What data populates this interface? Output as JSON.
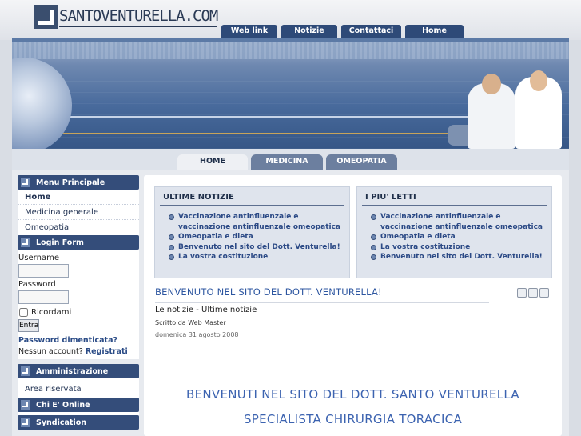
{
  "site": {
    "logo_text": "SANTOVENTURELLA.COM"
  },
  "top_nav": [
    {
      "label": "Web link"
    },
    {
      "label": "Notizie"
    },
    {
      "label": "Contattaci"
    },
    {
      "label": "Home"
    }
  ],
  "tabs": [
    {
      "label": "HOME",
      "active": true
    },
    {
      "label": "MEDICINA GENERALE",
      "active": false
    },
    {
      "label": "OMEOPATIA",
      "active": false
    }
  ],
  "sidebar": {
    "main_menu": {
      "title": "Menu Principale",
      "items": [
        {
          "label": "Home",
          "current": true
        },
        {
          "label": "Medicina generale",
          "current": false
        },
        {
          "label": "Omeopatia",
          "current": false
        }
      ]
    },
    "login": {
      "title": "Login Form",
      "username_label": "Username",
      "password_label": "Password",
      "username_value": "",
      "password_value": "",
      "remember_label": "Ricordami",
      "submit_label": "Entra",
      "forgot_label": "Password dimenticata?",
      "no_account_label": "Nessun account?",
      "register_label": "Registrati"
    },
    "admin": {
      "title": "Amministrazione",
      "items": [
        {
          "label": "Area riservata"
        }
      ]
    },
    "online": {
      "title": "Chi E' Online"
    },
    "syndication": {
      "title": "Syndication"
    }
  },
  "main": {
    "latest_news": {
      "title": "ULTIME NOTIZIE",
      "items": [
        "Vaccinazione antinfluenzale e vaccinazione antinfluenzale omeopatica",
        "Omeopatia e dieta",
        "Benvenuto nel sito del Dott. Venturella!",
        "La vostra costituzione"
      ]
    },
    "most_read": {
      "title": "I PIU' LETTI",
      "items": [
        "Vaccinazione antinfluenzale e vaccinazione antinfluenzale omeopatica",
        "Omeopatia e dieta",
        "La vostra costituzione",
        "Benvenuto nel sito del Dott. Venturella!"
      ]
    },
    "article": {
      "title": "BENVENUTO NEL SITO DEL DOTT. VENTURELLA!",
      "section": "Le notizie - Ultime notizie",
      "author": "Scritto da Web Master",
      "date": "domenica 31 agosto 2008",
      "icons": [
        "pdf-icon",
        "print-icon",
        "email-icon"
      ],
      "welcome_line1": "BENVENUTI NEL SITO DEL DOTT. SANTO VENTURELLA",
      "welcome_line2": "SPECIALISTA CHIRURGIA TORACICA"
    }
  }
}
